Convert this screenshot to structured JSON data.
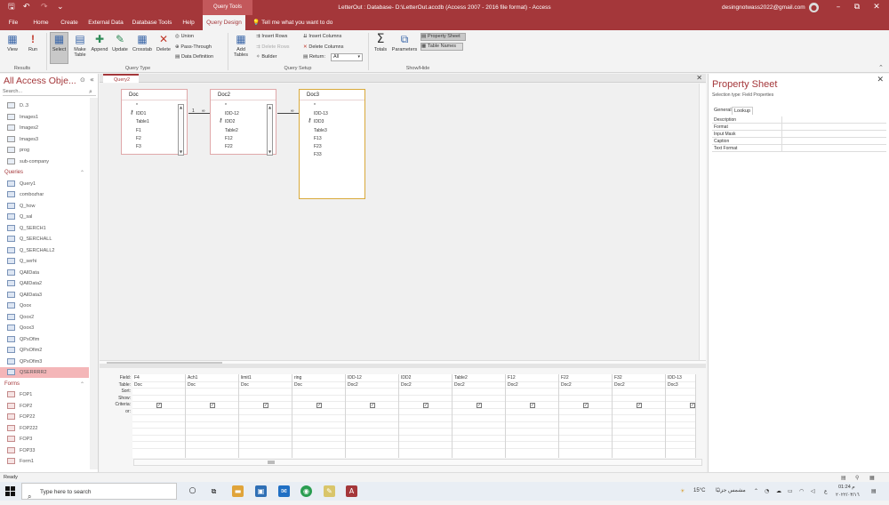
{
  "window": {
    "title": "LetterOut : Database- D:\\LetterOut.accdb (Access 2007 - 2016 file format) - Access",
    "context_tab": "Query Tools",
    "user": "desingnotwass2022@gmail.com",
    "controls": {
      "minimize": "–",
      "restore": "⧉",
      "maximize": "▢",
      "close": "✕"
    }
  },
  "quick_access": {
    "save": "🖫",
    "undo": "↶",
    "redo": "↷",
    "customize": "⌄"
  },
  "tabs": [
    "File",
    "Home",
    "Create",
    "External Data",
    "Database Tools",
    "Help",
    "Query Design"
  ],
  "tell_me": "Tell me what you want to do",
  "ribbon": {
    "results": {
      "label": "Results",
      "view": "View",
      "run": "Run"
    },
    "query_type": {
      "label": "Query Type",
      "select": "Select",
      "make_table": "Make Table",
      "append": "Append",
      "update": "Update",
      "crosstab": "Crosstab",
      "delete": "Delete",
      "union": "Union",
      "pass_through": "Pass-Through",
      "data_definition": "Data Definition"
    },
    "query_setup": {
      "label": "Query Setup",
      "add_tables": "Add Tables",
      "insert_rows": "Insert Rows",
      "delete_rows": "Delete Rows",
      "builder": "Builder",
      "insert_columns": "Insert Columns",
      "delete_columns": "Delete Columns",
      "return_label": "Return:",
      "return_value": "All"
    },
    "show_hide": {
      "label": "Show/Hide",
      "totals": "Totals",
      "parameters": "Parameters",
      "property_sheet": "Property Sheet",
      "table_names": "Table Names"
    }
  },
  "nav": {
    "title": "All Access Obje...",
    "search_placeholder": "Search...",
    "top_items": [
      "D..3",
      "Images1",
      "Images2",
      "Images3",
      "prog",
      "sub-company"
    ],
    "queries_header": "Queries",
    "queries": [
      "Query1",
      "combozhar",
      "Q_how",
      "Q_sal",
      "Q_SERCH1",
      "Q_SERCHALL",
      "Q_SERCHALL2",
      "Q_serhi",
      "QAllData",
      "QAllData2",
      "QAllData3",
      "Qoox",
      "Qoox2",
      "Qoox3",
      "QPxOfim",
      "QPxOfim2",
      "QPxOfim3",
      "QSERRRR2"
    ],
    "selected_query": "QSERRRR2",
    "forms_header": "Forms",
    "forms": [
      "FOP1",
      "FOP2",
      "FOP22",
      "FOP222",
      "FOP3",
      "FOP33",
      "Form1",
      "Form2"
    ]
  },
  "document": {
    "tab_label": "Query2"
  },
  "tables": [
    {
      "name": "Doc",
      "key_field": "IDD1",
      "fields": [
        "*",
        "IDD1",
        "Table1",
        "F1",
        "F2",
        "F3"
      ]
    },
    {
      "name": "Doc2",
      "key_field": "IDD2",
      "fields": [
        "*",
        "IDD-12",
        "IDD2",
        "Table2",
        "F12",
        "F22"
      ]
    },
    {
      "name": "Doc3",
      "key_field": "IDD3",
      "fields": [
        "*",
        "IDD-13",
        "IDD3",
        "Table3",
        "F13",
        "F23",
        "F33"
      ]
    }
  ],
  "relationship_labels": {
    "one": "1",
    "many": "∞"
  },
  "grid": {
    "row_labels": [
      "Field:",
      "Table:",
      "Sort:",
      "Show:",
      "Criteria:",
      "or:"
    ],
    "columns": [
      {
        "field": "F4",
        "table": "Doc",
        "show": true
      },
      {
        "field": "Ach1",
        "table": "Doc",
        "show": true
      },
      {
        "field": "limit1",
        "table": "Doc",
        "show": true
      },
      {
        "field": "ring",
        "table": "Doc",
        "show": true
      },
      {
        "field": "IDD-12",
        "table": "Doc2",
        "show": true
      },
      {
        "field": "IDD2",
        "table": "Doc2",
        "show": true
      },
      {
        "field": "Table2",
        "table": "Doc2",
        "show": true
      },
      {
        "field": "F12",
        "table": "Doc2",
        "show": true
      },
      {
        "field": "F22",
        "table": "Doc2",
        "show": true
      },
      {
        "field": "F32",
        "table": "Doc2",
        "show": true
      },
      {
        "field": "IDD-13",
        "table": "Doc3",
        "show": true
      }
    ]
  },
  "property_sheet": {
    "title": "Property Sheet",
    "selection_type": "Selection type: Field Properties",
    "tabs": [
      "General",
      "Lookup"
    ],
    "active_tab": "Lookup",
    "rows": [
      "Description",
      "Format",
      "Input Mask",
      "Caption",
      "Text Format"
    ]
  },
  "status": {
    "text": "Ready"
  },
  "taskbar": {
    "search_placeholder": "Type here to search",
    "weather": "15°C",
    "weather_text": "مشمس جزئيًا",
    "time": "01:24 م",
    "date": "٢٠٢٢/٠٣/١٦"
  },
  "colors": {
    "accent": "#a4373a",
    "selected_row": "#f4b6b8",
    "tab_fill": "#c3585b"
  }
}
